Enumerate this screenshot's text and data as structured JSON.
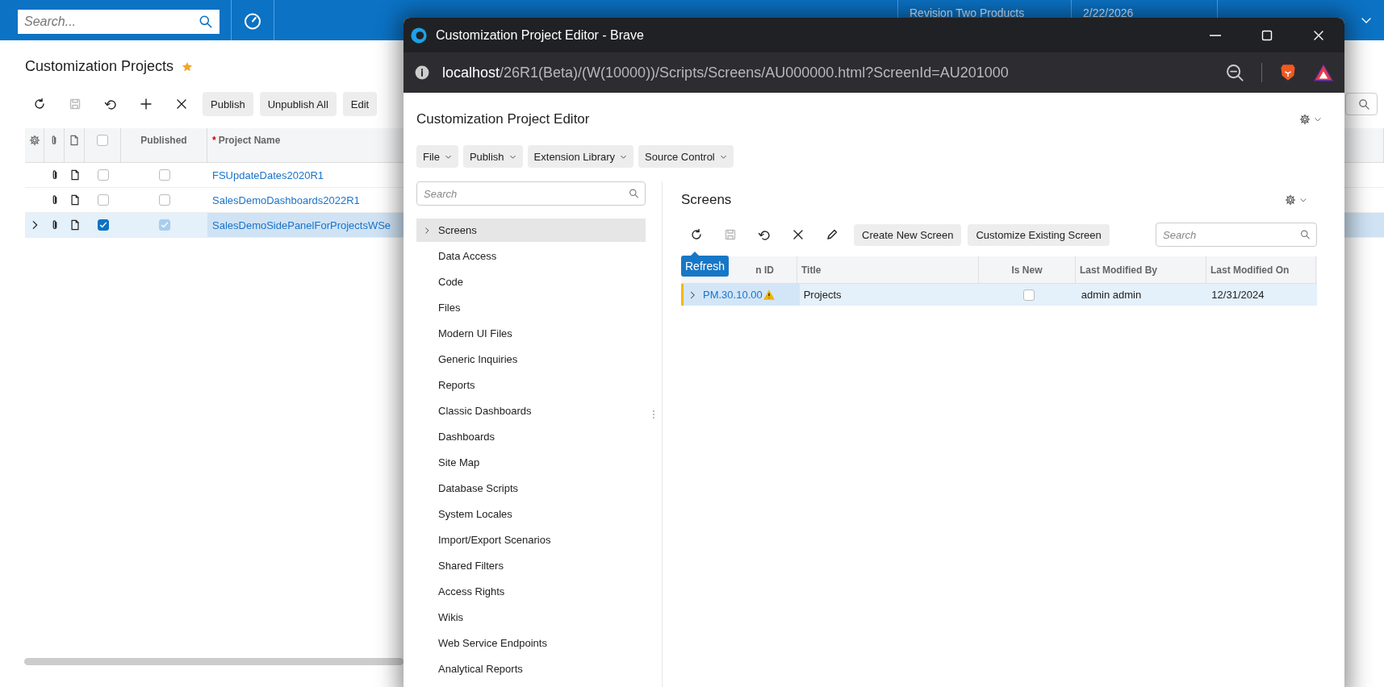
{
  "app": {
    "search": {
      "placeholder": "Search..."
    },
    "header_items": [
      {
        "text": "Revision Two Products"
      },
      {
        "text": "2/22/2026"
      }
    ]
  },
  "page": {
    "title": "Customization Projects",
    "favorite": true,
    "toolbar": {
      "buttons": [
        "Publish",
        "Unpublish All",
        "Edit"
      ]
    },
    "table": {
      "select_all": {
        "checked": false
      },
      "columns": [
        {
          "label": "Published"
        },
        {
          "label": "Project Name",
          "required_mark": "*"
        }
      ],
      "rows": [
        {
          "name": "FSUpdateDates2020R1",
          "selected": false,
          "checked": false,
          "published": false
        },
        {
          "name": "SalesDemoDashboards2022R1",
          "selected": false,
          "checked": false,
          "published": false
        },
        {
          "name": "SalesDemoSidePanelForProjectsWSe",
          "selected": true,
          "checked": true,
          "published": true
        }
      ]
    }
  },
  "window": {
    "title": "Customization Project Editor - Brave",
    "url_host": "localhost",
    "url_path": "/26R1(Beta)/(W(10000))/Scripts/Screens/AU000000.html?ScreenId=AU201000",
    "heading": "Customization Project Editor",
    "menus": [
      "File",
      "Publish",
      "Extension Library",
      "Source Control"
    ],
    "tree_search": {
      "placeholder": "Search"
    },
    "tree": [
      {
        "label": "Screens",
        "selected": true,
        "expandable": true
      },
      {
        "label": "Data Access",
        "selected": false,
        "expandable": false
      },
      {
        "label": "Code",
        "selected": false,
        "expandable": false
      },
      {
        "label": "Files",
        "selected": false,
        "expandable": false
      },
      {
        "label": "Modern UI Files",
        "selected": false,
        "expandable": false
      },
      {
        "label": "Generic Inquiries",
        "selected": false,
        "expandable": false
      },
      {
        "label": "Reports",
        "selected": false,
        "expandable": false
      },
      {
        "label": "Classic Dashboards",
        "selected": false,
        "expandable": false
      },
      {
        "label": "Dashboards",
        "selected": false,
        "expandable": false
      },
      {
        "label": "Site Map",
        "selected": false,
        "expandable": false
      },
      {
        "label": "Database Scripts",
        "selected": false,
        "expandable": false
      },
      {
        "label": "System Locales",
        "selected": false,
        "expandable": false
      },
      {
        "label": "Import/Export Scenarios",
        "selected": false,
        "expandable": false
      },
      {
        "label": "Shared Filters",
        "selected": false,
        "expandable": false
      },
      {
        "label": "Access Rights",
        "selected": false,
        "expandable": false
      },
      {
        "label": "Wikis",
        "selected": false,
        "expandable": false
      },
      {
        "label": "Web Service Endpoints",
        "selected": false,
        "expandable": false
      },
      {
        "label": "Analytical Reports",
        "selected": false,
        "expandable": false
      }
    ],
    "panel": {
      "title": "Screens",
      "buttons": [
        "Create New Screen",
        "Customize Existing Screen"
      ],
      "search": {
        "placeholder": "Search"
      },
      "tooltip": "Refresh",
      "columns": [
        {
          "label": "n ID"
        },
        {
          "label": "Title"
        },
        {
          "label": "Is New"
        },
        {
          "label": "Last Modified By"
        },
        {
          "label": "Last Modified On"
        }
      ],
      "rows": [
        {
          "screen_id": "PM.30.10.00",
          "warning": true,
          "title": "Projects",
          "is_new": false,
          "modified_by": "admin admin",
          "modified_on": "12/31/2024",
          "selected": true
        }
      ]
    }
  }
}
